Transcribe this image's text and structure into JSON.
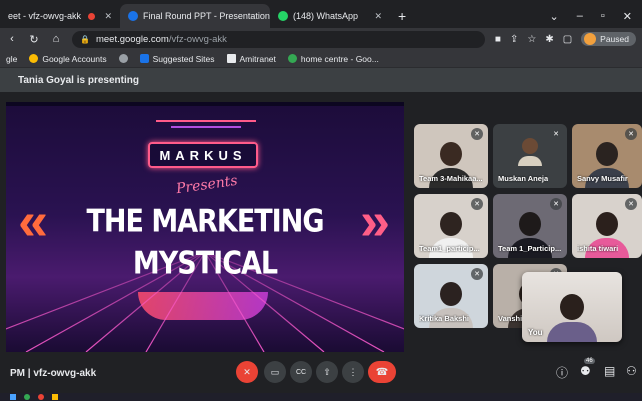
{
  "browser": {
    "tabs": [
      {
        "title": "eet - vfz-owvg-akk",
        "active": false,
        "favicon_color": "#ea4335"
      },
      {
        "title": "Final Round PPT - Presentation",
        "active": true,
        "favicon_color": "#1a73e8"
      },
      {
        "title": "(148) WhatsApp",
        "active": false,
        "favicon_color": "#25d366"
      }
    ],
    "new_tab_label": "+",
    "url_host": "meet.google.com",
    "url_path": "/vfz-owvg-akk",
    "profile_label": "Paused",
    "bookmarks": [
      {
        "label": "gle",
        "color": "#4285f4"
      },
      {
        "label": "Google Accounts",
        "color": "#fbbc04"
      },
      {
        "label": "",
        "color": "#9aa0a6"
      },
      {
        "label": "Suggested Sites",
        "color": "#1a73e8"
      },
      {
        "label": "Amitranet",
        "color": "#e8eaed"
      },
      {
        "label": "home centre - Goo...",
        "color": "#34a853"
      }
    ]
  },
  "meet": {
    "presenting_text": "Tania Goyal is presenting",
    "meeting_info": "PM  |  vfz-owvg-akk",
    "participants_count": "46",
    "slide": {
      "brand": "MARKUS",
      "presents": "Presents",
      "title_line1": "THE MARKETING",
      "title_line2": "MYSTICAL"
    },
    "tiles": [
      {
        "name": "Team 3-Mahikaa...",
        "bg": "#cfc6bd",
        "head": "#3a2a22",
        "body": "#2b2b2b",
        "muted": true
      },
      {
        "name": "Muskan Aneja",
        "bg": "#3c4043",
        "head": "#6b4a35",
        "body": "#d8d0c0",
        "muted": true
      },
      {
        "name": "Sanvy Musafir",
        "bg": "#a88b6e",
        "head": "#2a2320",
        "body": "#3a3f4a",
        "muted": true
      },
      {
        "name": "Team1_particip...",
        "bg": "#d7d1cb",
        "head": "#2e2420",
        "body": "#f0f0f0",
        "muted": true
      },
      {
        "name": "Team 1_Particip...",
        "bg": "#6d6a74",
        "head": "#1e1a1a",
        "body": "#1a1a22",
        "muted": true
      },
      {
        "name": "ishita tiwari",
        "bg": "#d8d2cc",
        "head": "#2b201c",
        "body": "#e75a9a",
        "muted": true
      },
      {
        "name": "Kritika Bakshi",
        "bg": "#cfd6dc",
        "head": "#2b2220",
        "body": "#c7c1bd",
        "muted": true
      },
      {
        "name": "Vanshi",
        "bg": "#b9b0a8",
        "head": "#2a201c",
        "body": "#3b3330",
        "muted": true
      }
    ],
    "self_label": "You"
  },
  "icons": {
    "mic_off": "🎙",
    "camera": "▭",
    "captions": "CC",
    "present": "⇧",
    "more": "⋮",
    "hangup": "✆",
    "info": "ⓘ",
    "people": "👥",
    "chat": "▤",
    "activities": "⚇"
  },
  "colors": {
    "accent_red": "#ea4335",
    "background": "#202124"
  }
}
